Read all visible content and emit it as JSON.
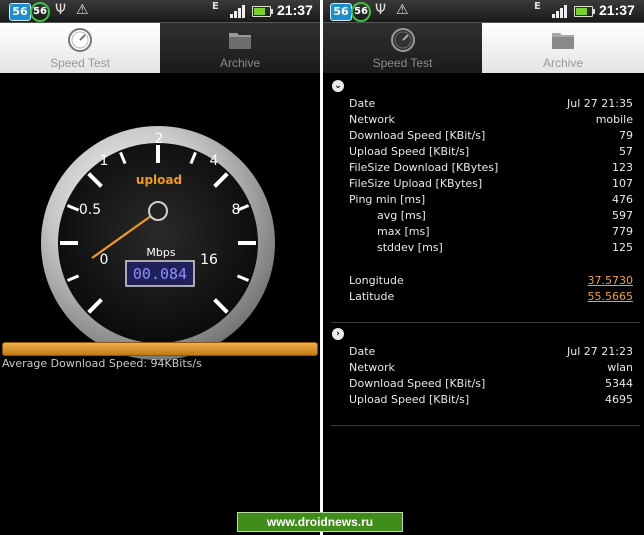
{
  "status": {
    "badge1": "56",
    "badge2": "56",
    "signal_mark": "E",
    "time": "21:37",
    "icons": [
      "usb-icon",
      "warning-icon",
      "signal-icon",
      "battery-icon"
    ]
  },
  "tabs": {
    "speed_test": "Speed Test",
    "archive": "Archive"
  },
  "gauge": {
    "mode_label": "upload",
    "unit_label": "Mbps",
    "readout": "00.084",
    "scale_labels": [
      "0",
      "0.5",
      "1",
      "2",
      "4",
      "8",
      "16"
    ],
    "needle_value": 0.084,
    "accent_color": "#f09a20"
  },
  "progress": {
    "fill": 1.0,
    "color": "#e39a2c"
  },
  "average_text": "Average Download Speed: 94KBits/s",
  "archive": {
    "entries": [
      {
        "expanded": true,
        "rows": [
          {
            "key": "Date",
            "value": "Jul 27  21:35"
          },
          {
            "key": "Network",
            "value": "mobile"
          },
          {
            "key": "Download Speed [KBit/s]",
            "value": "79"
          },
          {
            "key": "Upload Speed [KBit/s]",
            "value": "57"
          },
          {
            "key": "FileSize Download [KBytes]",
            "value": "123"
          },
          {
            "key": "FileSize Upload [KBytes]",
            "value": "107"
          },
          {
            "key": "Ping  min [ms]",
            "value": "476"
          },
          {
            "key": "avg [ms]",
            "value": "597"
          },
          {
            "key": "max [ms]",
            "value": "779"
          },
          {
            "key": "stddev [ms]",
            "value": "125"
          }
        ],
        "longitude_label": "Longitude",
        "longitude": "37.5730",
        "latitude_label": "Latitude",
        "latitude": "55.5665"
      },
      {
        "expanded": false,
        "rows": [
          {
            "key": "Date",
            "value": "Jul 27  21:23"
          },
          {
            "key": "Network",
            "value": "wlan"
          },
          {
            "key": "Download Speed [KBit/s]",
            "value": "5344"
          },
          {
            "key": "Upload Speed [KBit/s]",
            "value": "4695"
          }
        ]
      }
    ]
  },
  "watermark": "www.droidnews.ru"
}
